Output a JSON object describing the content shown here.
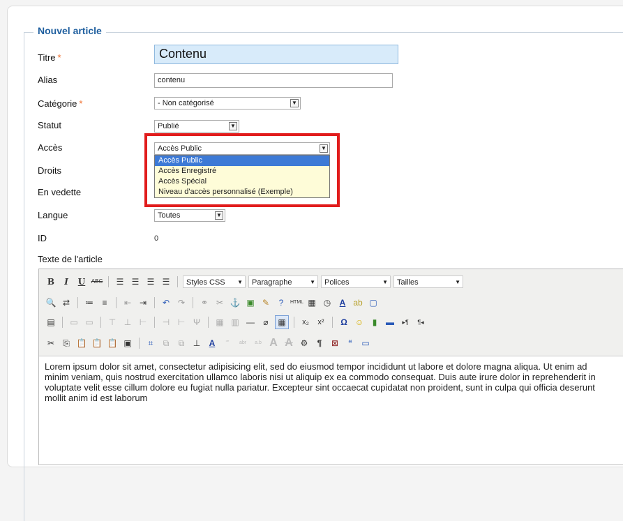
{
  "form": {
    "legend": "Nouvel article",
    "labels": {
      "titre": "Titre",
      "alias": "Alias",
      "categorie": "Catégorie",
      "statut": "Statut",
      "acces": "Accès",
      "droits": "Droits",
      "vedette": "En vedette",
      "langue": "Langue",
      "id": "ID",
      "texte": "Texte de l'article"
    },
    "required_mark": "*",
    "values": {
      "titre": "Contenu",
      "alias": "contenu",
      "categorie": "- Non catégorisé",
      "statut": "Publié",
      "acces": "Accès Public",
      "langue": "Toutes",
      "id": "0"
    },
    "acces_options": [
      "Accès Public",
      "Accès Enregistré",
      "Accès Spécial",
      "Niveau d'accès personnalisé (Exemple)"
    ]
  },
  "editor": {
    "toolbar_row1": {
      "bold": "B",
      "italic": "I",
      "underline": "U",
      "strike": "ABC",
      "styles": "Styles CSS",
      "format": "Paragraphe",
      "fonts": "Polices",
      "sizes": "Tailles"
    },
    "content": "Lorem ipsum dolor sit amet, consectetur adipisicing elit, sed do eiusmod tempor incididunt ut labore et dolore magna aliqua. Ut enim ad minim veniam, quis nostrud exercitation ullamco laboris nisi ut aliquip ex ea commodo consequat. Duis aute irure dolor in reprehenderit in voluptate velit esse cillum dolore eu fugiat nulla pariatur. Excepteur sint occaecat cupidatat non proident, sunt in culpa qui officia deserunt mollit anim id est laborum"
  },
  "colors": {
    "legend": "#1f5f9f",
    "highlight_box": "#e11c1c",
    "selected_option": "#3d7ad6",
    "title_field": "#d8ebfa"
  }
}
